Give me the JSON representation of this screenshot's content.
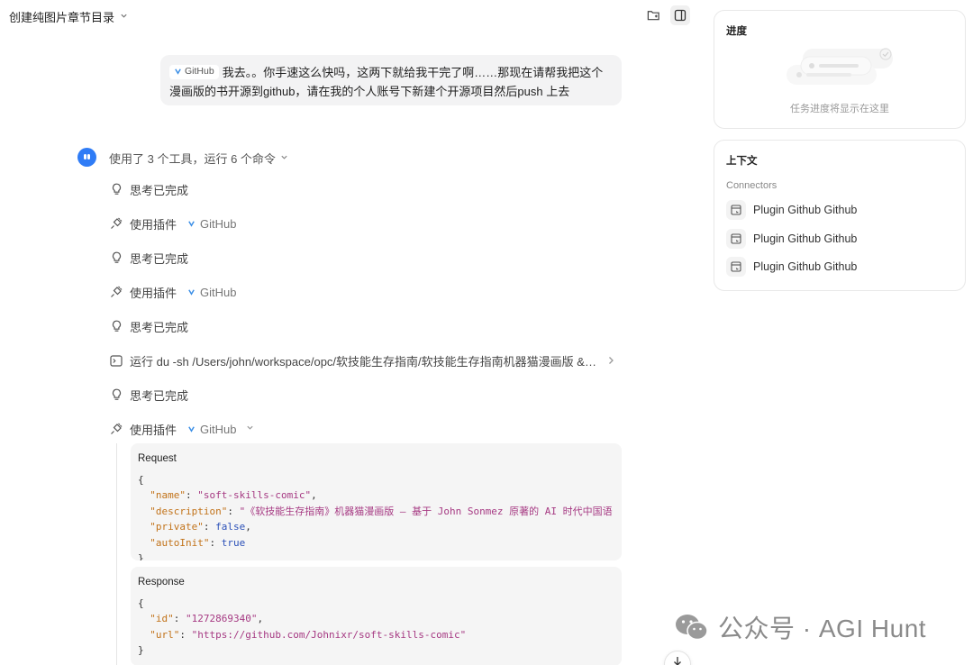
{
  "header": {
    "title": "创建纯图片章节目录"
  },
  "user_message": {
    "chip_label": "GitHub",
    "text": "我去。。你手速这么快吗，这两下就给我干完了啊……那现在请帮我把这个漫画版的书开源到github，请在我的个人账号下新建个开源项目然后push 上去"
  },
  "assistant": {
    "summary": "使用了 3 个工具，运行 6 个命令",
    "steps": [
      {
        "type": "think",
        "label": "思考已完成"
      },
      {
        "type": "plugin",
        "label": "使用插件",
        "plugin": "GitHub"
      },
      {
        "type": "think",
        "label": "思考已完成"
      },
      {
        "type": "plugin",
        "label": "使用插件",
        "plugin": "GitHub"
      },
      {
        "type": "think",
        "label": "思考已完成"
      },
      {
        "type": "run",
        "label": "运行 du -sh /Users/john/workspace/opc/软技能生存指南/软技能生存指南机器猫漫画版 && \\..."
      },
      {
        "type": "think",
        "label": "思考已完成"
      },
      {
        "type": "plugin",
        "label": "使用插件",
        "plugin": "GitHub"
      }
    ],
    "request": {
      "label": "Request",
      "name_key": "\"name\"",
      "name_val": "\"soft-skills-comic\"",
      "desc_key": "\"description\"",
      "desc_val": "\"《软技能生存指南》机器猫漫画版 — 基于 John Sonmez 原著的 AI 时代中国语",
      "private_key": "\"private\"",
      "private_val": "false",
      "autoinit_key": "\"autoInit\"",
      "autoinit_val": "true"
    },
    "response": {
      "label": "Response",
      "id_key": "\"id\"",
      "id_val": "\"1272869340\"",
      "url_key": "\"url\"",
      "url_val": "\"https://github.com/Johnixr/soft-skills-comic\""
    }
  },
  "sidebar": {
    "progress": {
      "title": "进度",
      "empty_text": "任务进度将显示在这里"
    },
    "context": {
      "title": "上下文",
      "section": "Connectors",
      "connectors": [
        "Plugin Github Github",
        "Plugin Github Github",
        "Plugin Github Github"
      ]
    }
  },
  "watermark": {
    "text": "公众号 · AGI Hunt"
  },
  "colors": {
    "accent": "#2f7cf6",
    "json_key": "#c2731a",
    "json_string": "#a63a83",
    "json_literal": "#2b50b8"
  }
}
